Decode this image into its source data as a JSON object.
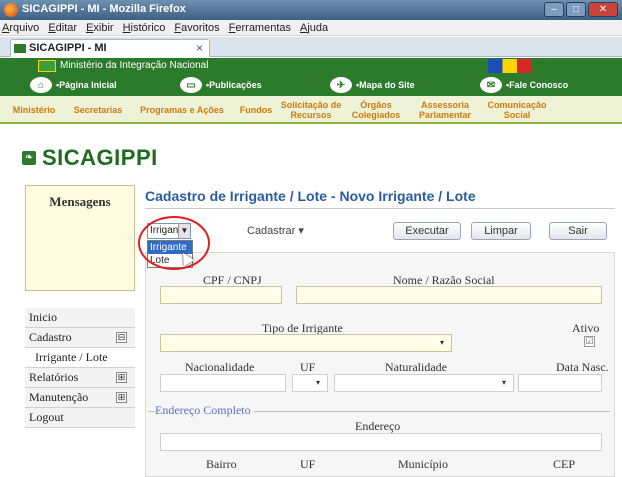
{
  "window": {
    "title": "SICAGIPPI - MI - Mozilla Firefox",
    "controls": [
      "–",
      "□",
      "✕"
    ]
  },
  "menubar": [
    "Arquivo",
    "Editar",
    "Exibir",
    "Histórico",
    "Favoritos",
    "Ferramentas",
    "Ajuda"
  ],
  "tab": {
    "label": "SICAGIPPI - MI",
    "close": "×"
  },
  "gov_header": {
    "ministry": "Ministério da Integração Nacional",
    "links": [
      "•Página Inicial",
      "•Publicações",
      "•Mapa do Site",
      "•Fale Conosco"
    ]
  },
  "section_nav": [
    "Ministério",
    "Secretarias",
    "Programas e Ações",
    "Fundos",
    "Solicitação de Recursos",
    "Órgãos Colegiados",
    "Assessoria Parlamentar",
    "Comunicação Social"
  ],
  "logo": {
    "text": "SICAGIPPI"
  },
  "messages": {
    "title": "Mensagens"
  },
  "side_menu": [
    {
      "label": "Inicio"
    },
    {
      "label": "Cadastro",
      "toggle": "⊟"
    },
    {
      "label": "Irrigante / Lote",
      "sub": true
    },
    {
      "label": "Relatórios",
      "toggle": "⊞"
    },
    {
      "label": "Manutenção",
      "toggle": "⊞"
    },
    {
      "label": "Logout"
    }
  ],
  "page": {
    "title": "Cadastro de Irrigante / Lote - Novo Irrigante / Lote"
  },
  "toolbar": {
    "combo_value": "Irrigante",
    "combo_arrow": "▼",
    "dropdown_options": [
      "Irrigante",
      "Lote"
    ],
    "dropdown_selected_index": 0,
    "cadastrar": "Cadastrar ▾",
    "executar": "Executar",
    "limpar": "Limpar",
    "sair": "Sair"
  },
  "form": {
    "cpf_label": "CPF / CNPJ",
    "nome_label": "Nome / Razão Social",
    "tipo_label": "Tipo de Irrigante",
    "ativo_label": "Ativo",
    "ativo_check": "☑",
    "nacionalidade_label": "Nacionalidade",
    "uf_label": "UF",
    "naturalidade_label": "Naturalidade",
    "data_nasc_label": "Data Nasc.",
    "endereco_legend": "Endereço Completo",
    "endereco_label": "Endereço",
    "bairro_label": "Bairro",
    "uf2_label": "UF",
    "municipio_label": "Município",
    "cep_label": "CEP",
    "select_arrow": "▾"
  },
  "colors": {
    "gov_green": "#2c7a2c",
    "orange_text": "#d07a0a",
    "title_blue": "#2a5d9f",
    "highlight_red": "#e02020"
  }
}
